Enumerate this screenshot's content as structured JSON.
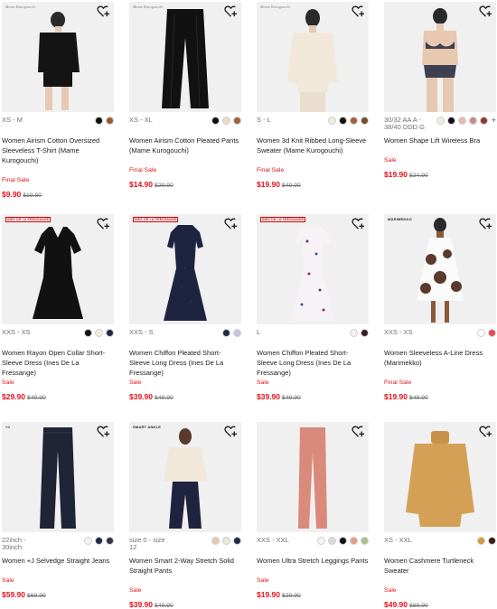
{
  "colors": {
    "sale_red": "#e0131a",
    "image_bg": "#f0f0f0",
    "text": "#1b1b1b",
    "muted": "#6e6e6e"
  },
  "wishlist_icon": "heart-plus-icon",
  "products": [
    {
      "sizes": "XS - M",
      "swatches": [
        "#111111",
        "#9a5b2e"
      ],
      "name": "Women Airism Cotton Oversized Sleeveless T-Shirt (Mame Kurogouchi)",
      "flag": "Final Sale",
      "price": "$9.90",
      "was": "$19.90"
    },
    {
      "sizes": "XS - XL",
      "swatches": [
        "#111111",
        "#e8dcc8",
        "#a0623a"
      ],
      "name": "Women Airism Cotton Pleated Pants (Mame Kurogouchi)",
      "flag": "Final Sale",
      "price": "$14.90",
      "was": "$29.90"
    },
    {
      "sizes": "S - L",
      "swatches": [
        "#f4ece0",
        "#111111",
        "#a0623a",
        "#7a4a2a"
      ],
      "name": "Women 3d Knit Ribbed Long-Sleeve Sweater (Mame Kurogouchi)",
      "flag": "Final Sale",
      "price": "$19.90",
      "was": "$49.90"
    },
    {
      "sizes": "30/32 AA A - 38/40 DDD G",
      "swatches": [
        "#f4ece0",
        "#111111",
        "#e9b9b0",
        "#cc8a8a",
        "#8a3a3a",
        "#5a3a5a"
      ],
      "name": "Women Shape Lift Wireless Bra",
      "flag": "Sale",
      "price": "$19.90",
      "was": "$24.90"
    },
    {
      "sizes": "XXS - XS",
      "swatches": [
        "#111111",
        "#f4ece0",
        "#1f2a44"
      ],
      "name": "Women Rayon Open Collar Short-Sleeve Dress (Ines De La Fressange)",
      "flag": "Sale",
      "price": "$29.90",
      "was": "$49.90"
    },
    {
      "sizes": "XXS - S",
      "swatches": [
        "#1f2a44",
        "#c8c4e0"
      ],
      "name": "Women Chiffon Pleated Short-Sleeve Long Dress (Ines De La Fressange)",
      "flag": "Sale",
      "price": "$39.90",
      "was": "$49.90"
    },
    {
      "sizes": "L",
      "swatches": [
        "#f4f0f4",
        "#3a1a2a"
      ],
      "name": "Women Chiffon Pleated Short-Sleeve Long Dress (Ines De La Fressange)",
      "flag": "Sale",
      "price": "$39.90",
      "was": "$49.90"
    },
    {
      "sizes": "XXS - XS",
      "swatches": [
        "#ffffff",
        "#e84a5a"
      ],
      "name": "Women Sleeveless A-Line Dress (Marimekko)",
      "flag": "Final Sale",
      "price": "$19.90",
      "was": "$49.90"
    },
    {
      "sizes": "22inch - 30inch",
      "swatches": [
        "#f4f4f4",
        "#1f2a44",
        "#333344"
      ],
      "name": "Women +J Selvedge Straight Jeans",
      "flag": "Sale",
      "price": "$59.90",
      "was": "$69.90"
    },
    {
      "sizes": "size 0 - size 12",
      "swatches": [
        "#e8c8b0",
        "#ece8dc",
        "#1f2a44"
      ],
      "name": "Women Smart 2-Way Stretch Solid Straight Pants",
      "flag": "Sale",
      "price": "$39.90",
      "was": "$49.90"
    },
    {
      "sizes": "XXS - XXL",
      "swatches": [
        "#f4f4f4",
        "#d8d8d8",
        "#111111",
        "#e89a8a",
        "#a8c48a"
      ],
      "name": "Women Ultra Stretch Leggings Pants",
      "flag": "Sale",
      "price": "$19.90",
      "was": "$29.90"
    },
    {
      "sizes": "XS - XXL",
      "swatches": [
        "#d8963a",
        "#3a1a1a"
      ],
      "name": "Women Cashmere Turtleneck Sweater",
      "flag": "Sale",
      "price": "$49.90",
      "was": "$89.90"
    }
  ],
  "badges": {
    "p0": "Mame Kurogouchi",
    "p1": "Mame Kurogouchi",
    "p2": "Mame Kurogouchi",
    "p4": "INES DE LA FRESSANGE",
    "p5": "INES DE LA FRESSANGE",
    "p6": "INES DE LA FRESSANGE",
    "p7": "MARIMEKKO",
    "p8": "+J",
    "p9": "SMART ANKLE"
  }
}
